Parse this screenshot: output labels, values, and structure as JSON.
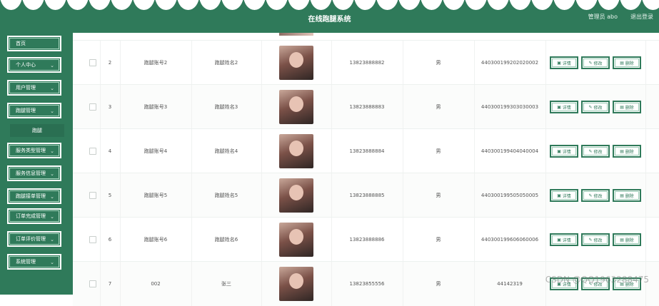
{
  "header": {
    "title": "在线跑腿系统",
    "user": "管理员 abo",
    "logout": "退出登录"
  },
  "sidebar": {
    "items": [
      {
        "label": "首页",
        "chevron": false
      },
      {
        "label": "个人中心",
        "chevron": true
      },
      {
        "label": "用户管理",
        "chevron": true
      },
      {
        "label": "跑腿管理",
        "chevron": true
      },
      {
        "label": "服务类型管理",
        "chevron": true
      },
      {
        "label": "服务信息管理",
        "chevron": true
      },
      {
        "label": "跑腿接单管理",
        "chevron": true
      },
      {
        "label": "订单完成管理",
        "chevron": true
      },
      {
        "label": "订单评价管理",
        "chevron": true
      },
      {
        "label": "系统管理",
        "chevron": true
      }
    ],
    "sub_item": "跑腿"
  },
  "table": {
    "rows": [
      {
        "index": "2",
        "account": "跑腿账号2",
        "name": "跑腿姓名2",
        "phone": "13823888882",
        "gender": "男",
        "id_card": "440300199202020002"
      },
      {
        "index": "3",
        "account": "跑腿账号3",
        "name": "跑腿姓名3",
        "phone": "13823888883",
        "gender": "男",
        "id_card": "440300199303030003"
      },
      {
        "index": "4",
        "account": "跑腿账号4",
        "name": "跑腿姓名4",
        "phone": "13823888884",
        "gender": "男",
        "id_card": "440300199404040004"
      },
      {
        "index": "5",
        "account": "跑腿账号5",
        "name": "跑腿姓名5",
        "phone": "13823888885",
        "gender": "男",
        "id_card": "440300199505050005"
      },
      {
        "index": "6",
        "account": "跑腿账号6",
        "name": "跑腿姓名6",
        "phone": "13823888886",
        "gender": "男",
        "id_card": "440300199606060006"
      },
      {
        "index": "7",
        "account": "002",
        "name": "张三",
        "phone": "13823855556",
        "gender": "男",
        "id_card": "44142319"
      }
    ],
    "buttons": {
      "detail": "详情",
      "edit": "修改",
      "delete": "删除"
    }
  },
  "watermark": "CSDN @QQ1963288475",
  "colors": {
    "primary": "#2f7a5a",
    "accent_border": "#9bcbb5"
  }
}
